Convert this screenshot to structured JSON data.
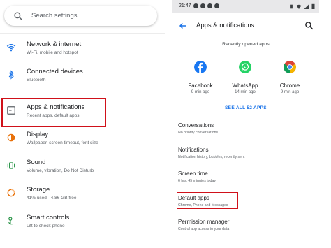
{
  "left": {
    "search_placeholder": "Search settings",
    "items": [
      {
        "title": "Network & internet",
        "subtitle": "Wi-Fi, mobile and hotspot",
        "icon": "wifi-icon",
        "color": "#1a73e8"
      },
      {
        "title": "Connected devices",
        "subtitle": "Bluetooth",
        "icon": "bluetooth-icon",
        "color": "#1a73e8"
      },
      {
        "title": "Apps & notifications",
        "subtitle": "Recent apps, default apps",
        "icon": "apps-icon",
        "color": "#5f6368"
      },
      {
        "title": "Display",
        "subtitle": "Wallpaper, screen timeout, font size",
        "icon": "display-icon",
        "color": "#e8710a"
      },
      {
        "title": "Sound",
        "subtitle": "Volume, vibration, Do Not Disturb",
        "icon": "sound-icon",
        "color": "#1e8e3e"
      },
      {
        "title": "Storage",
        "subtitle": "41% used - 4.86 GB free",
        "icon": "storage-icon",
        "color": "#e8710a"
      },
      {
        "title": "Smart controls",
        "subtitle": "Lift to check phone",
        "icon": "smart-controls-icon",
        "color": "#1e8e3e"
      }
    ],
    "highlight_color": "#d0111a"
  },
  "right": {
    "status": {
      "time": "21:47"
    },
    "page_title": "Apps & notifications",
    "recent_label": "Recently opened apps",
    "recent_apps": [
      {
        "name": "Facebook",
        "time": "9 min ago",
        "icon": "facebook-icon"
      },
      {
        "name": "WhatsApp",
        "time": "14 min ago",
        "icon": "whatsapp-icon"
      },
      {
        "name": "Chrome",
        "time": "9 min ago",
        "icon": "chrome-icon"
      }
    ],
    "see_all": "SEE ALL 52 APPS",
    "items": [
      {
        "title": "Conversations",
        "subtitle": "No priority conversations"
      },
      {
        "title": "Notifications",
        "subtitle": "Notification history, bubbles, recently sent"
      },
      {
        "title": "Screen time",
        "subtitle": "6 hrs, 45 minutes today"
      },
      {
        "title": "Default apps",
        "subtitle": "Chrome, Phone and Messages"
      },
      {
        "title": "Permission manager",
        "subtitle": "Control app access to your data"
      }
    ],
    "accent_color": "#1a73e8"
  }
}
